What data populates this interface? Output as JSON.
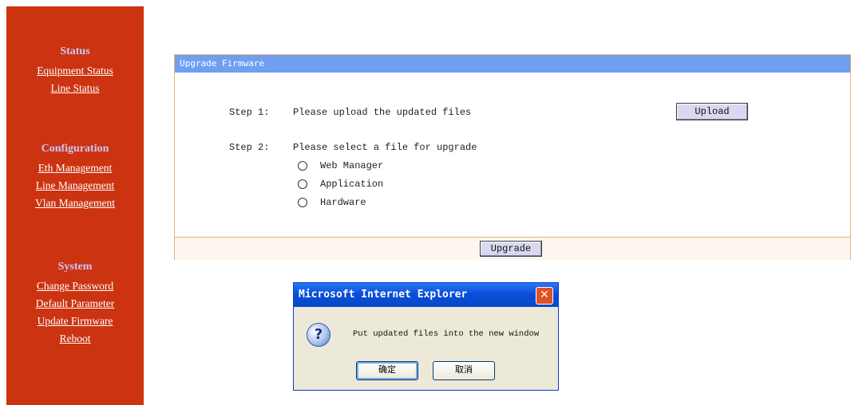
{
  "sidebar": {
    "sections": [
      {
        "heading": "Status",
        "links": [
          "Equipment Status",
          "Line Status"
        ]
      },
      {
        "heading": "Configuration",
        "links": [
          "Eth Management",
          "Line Management",
          "Vlan Management"
        ]
      },
      {
        "heading": "System",
        "links": [
          "Change Password",
          "Default Parameter",
          "Update Firmware",
          "Reboot"
        ]
      }
    ]
  },
  "panel": {
    "title": "Upgrade Firmware",
    "step1": {
      "label": "Step 1:",
      "text": "Please upload the updated files",
      "button": "Upload"
    },
    "step2": {
      "label": "Step 2:",
      "text": "Please select a file for upgrade",
      "options": [
        "Web Manager",
        "Application",
        "Hardware"
      ]
    },
    "upgrade_button": "Upgrade"
  },
  "dialog": {
    "title": "Microsoft Internet Explorer",
    "close_glyph": "✕",
    "icon": "question-icon",
    "icon_glyph": "?",
    "message": "Put updated files into the new window",
    "ok_label": "确定",
    "cancel_label": "取消"
  },
  "colors": {
    "sidebar_bg": "#cc3311",
    "panel_title_bg": "#6e9ff0",
    "panel_border": "#f3b070"
  }
}
